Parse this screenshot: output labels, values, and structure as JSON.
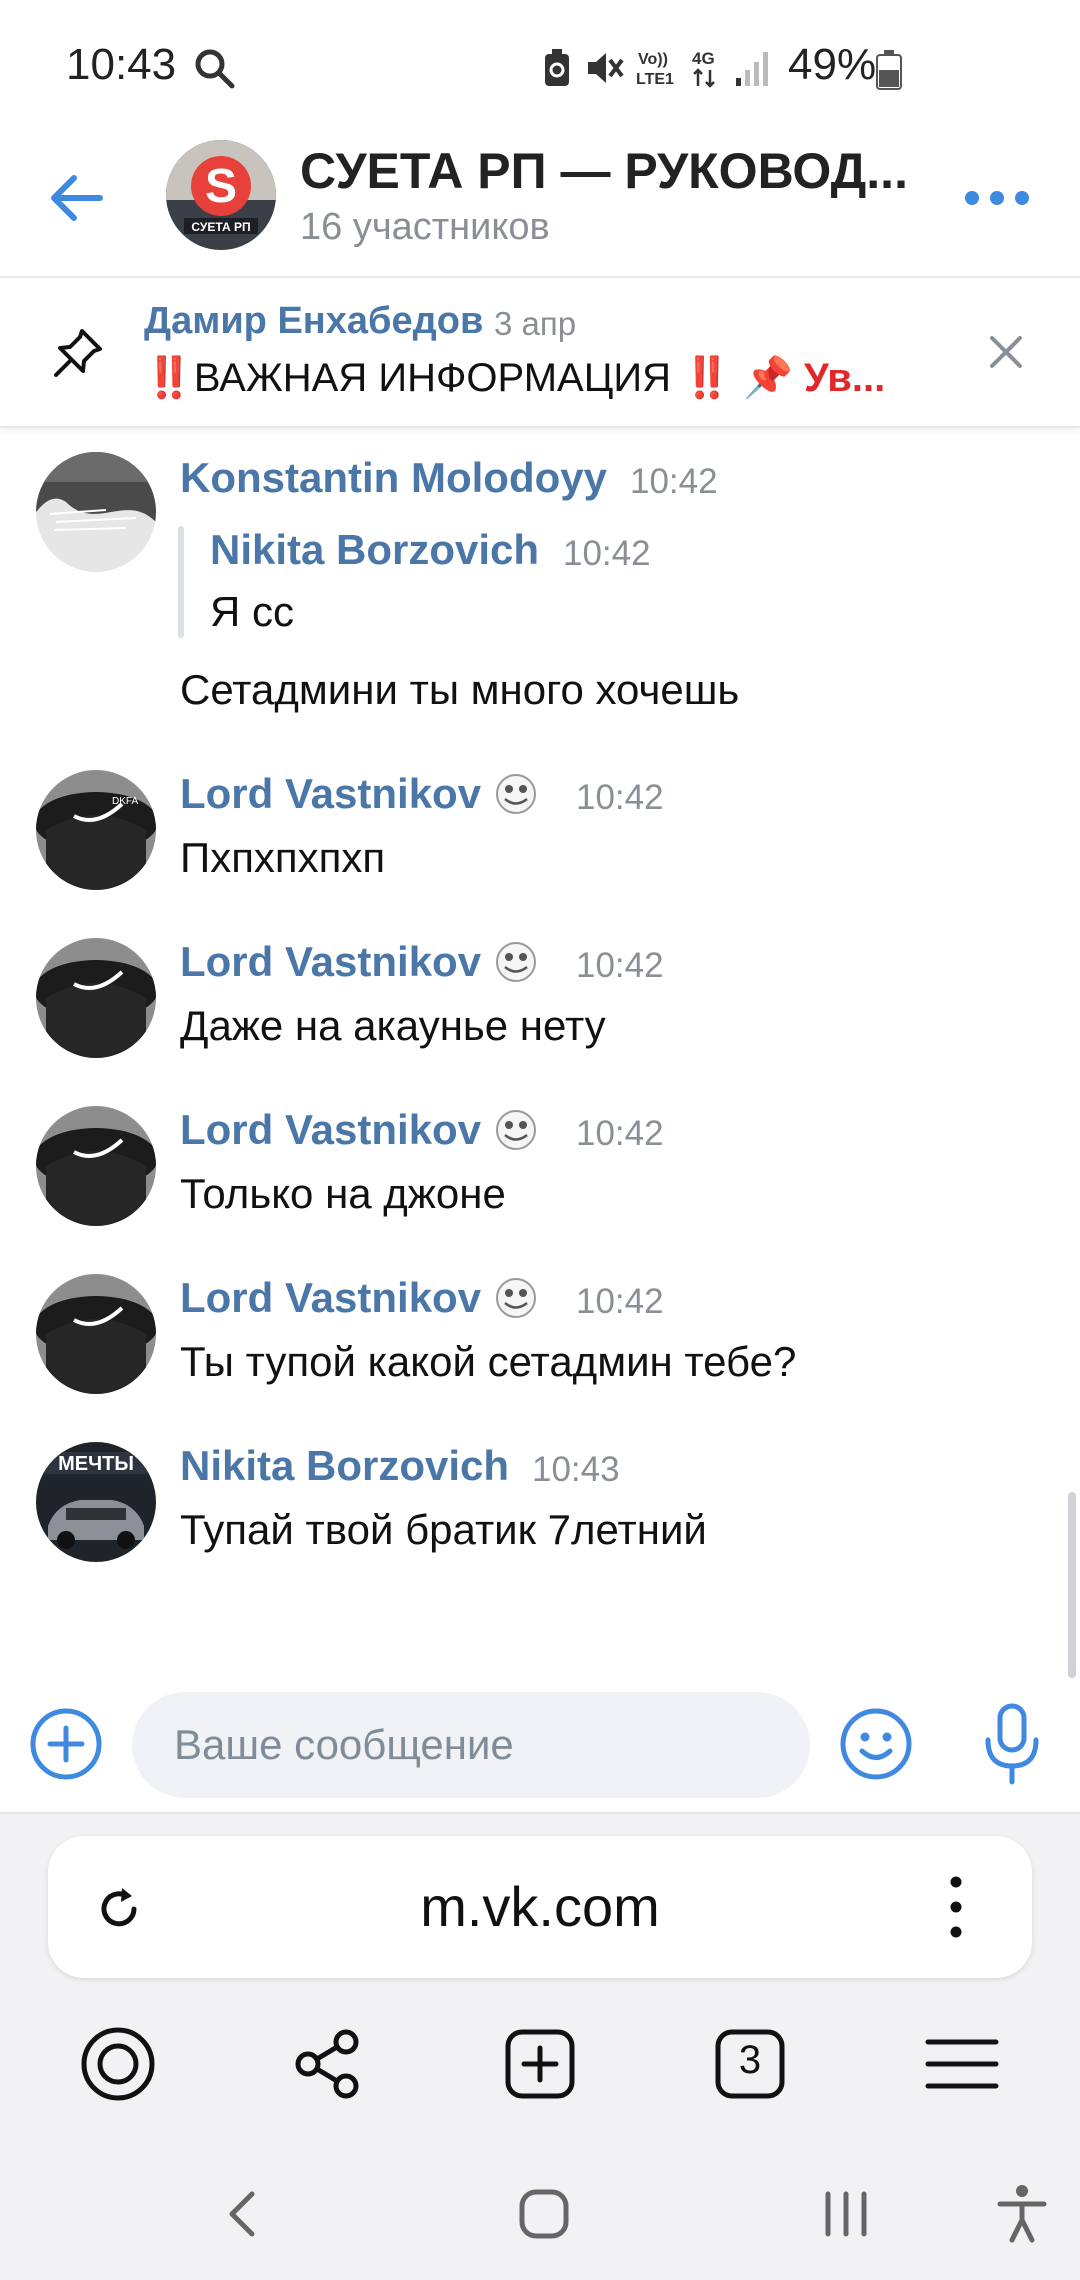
{
  "status_bar": {
    "time": "10:43",
    "battery": "49%"
  },
  "chat": {
    "title": "СУЕТА РП — РУКОВОД...",
    "subtitle": "16 участников",
    "avatar_caption": "СУЕТА РП"
  },
  "pinned": {
    "author": "Дамир Енхабедов",
    "date": "3 апр",
    "text_prefix": "‼️",
    "text": "ВАЖНАЯ ИНФОРМАЦИЯ ",
    "text_suffix": "‼️ 📌 Ув..."
  },
  "messages": [
    {
      "author": "Konstantin Molodoyy",
      "time": "10:42",
      "reply": {
        "author": "Nikita Borzovich",
        "time": "10:42",
        "text": "Я сс"
      },
      "text": "Сетадмини ты много хочешь"
    },
    {
      "author": "Lord Vastnikov",
      "time": "10:42",
      "text": "Пхпхпхпхп"
    },
    {
      "author": "Lord Vastnikov",
      "time": "10:42",
      "text": "Даже на акаунье нету"
    },
    {
      "author": "Lord Vastnikov",
      "time": "10:42",
      "text": "Только на джоне"
    },
    {
      "author": "Lord Vastnikov",
      "time": "10:42",
      "text": "Ты тупой какой сетадмин тебе?"
    },
    {
      "author": "Nikita Borzovich",
      "time": "10:43",
      "text": "Тупай твой братик 7летний",
      "avatar_caption": "МЕЧТЫ"
    }
  ],
  "composer": {
    "placeholder": "Ваше сообщение"
  },
  "browser": {
    "url": "m.vk.com",
    "tabs_count": "3"
  },
  "colors": {
    "accent": "#4a76a8",
    "icon_blue": "#3f8ae0",
    "muted": "#8a8f96"
  }
}
